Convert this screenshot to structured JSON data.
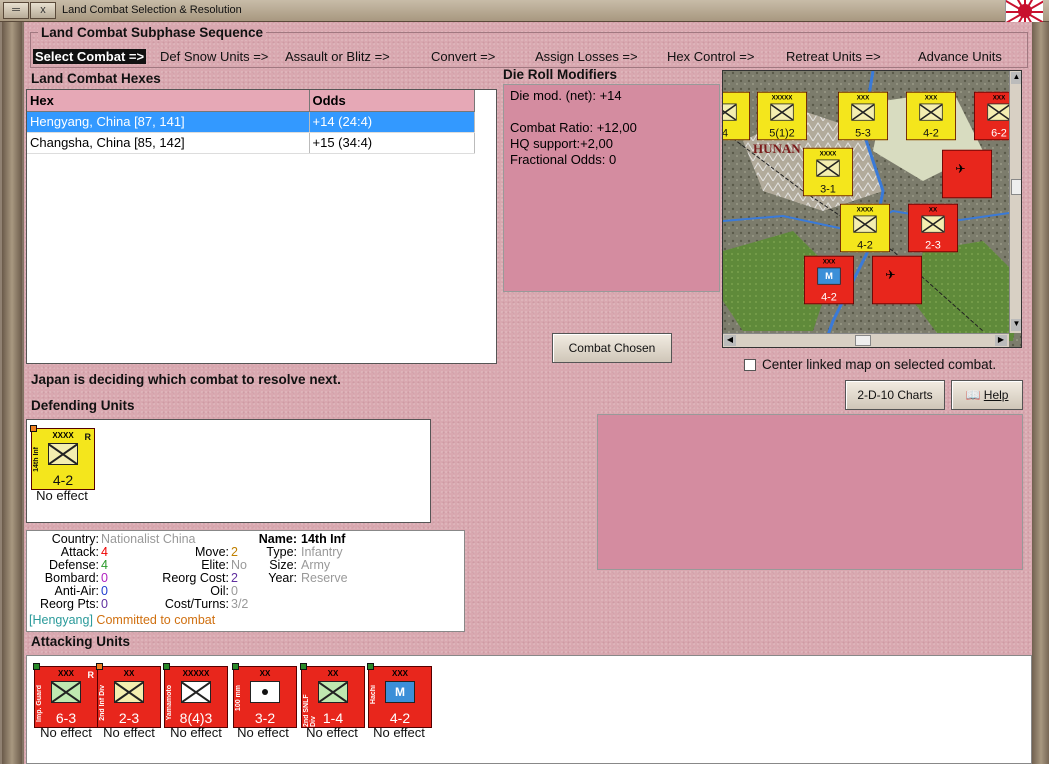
{
  "window": {
    "title": "Land Combat Selection & Resolution",
    "close_label": "x",
    "menu_label": "═"
  },
  "sequence": {
    "title": "Land Combat Subphase Sequence",
    "steps": [
      "Select Combat =>",
      "Def Snow Units =>",
      "Assault or Blitz =>",
      "Convert =>",
      "Assign Losses =>",
      "Hex Control =>",
      "Retreat Units =>",
      "Advance Units"
    ],
    "active_index": 0
  },
  "hexes": {
    "title": "Land Combat Hexes",
    "columns": [
      "Hex",
      "Odds"
    ],
    "rows": [
      {
        "hex": "Hengyang, China [87, 141]",
        "odds": "+14 (24:4)",
        "selected": true
      },
      {
        "hex": "Changsha, China [85, 142]",
        "odds": "+15 (34:4)",
        "selected": false
      }
    ]
  },
  "die_roll": {
    "title": "Die Roll Modifiers",
    "lines": [
      "Die mod. (net): +14",
      "",
      "Combat Ratio: +12,00",
      "HQ support:+2,00",
      "Fractional Odds: 0"
    ]
  },
  "buttons": {
    "combat_chosen": "Combat Chosen",
    "charts": "2-D-10 Charts",
    "help": "Help"
  },
  "center_map_label": "Center linked map on selected combat.",
  "status_message": "Japan is deciding which combat to resolve next.",
  "defending": {
    "title": "Defending Units",
    "units": [
      {
        "name": "14th Inf",
        "size": "XXXX",
        "flag": "R",
        "strength": "4-2",
        "effect": "No effect"
      }
    ]
  },
  "unit_info": {
    "country_label": "Country:",
    "country": "Nationalist China",
    "attack_label": "Attack:",
    "attack": "4",
    "defense_label": "Defense:",
    "defense": "4",
    "bombard_label": "Bombard:",
    "bombard": "0",
    "antiair_label": "Anti-Air:",
    "antiair": "0",
    "reorg_pts_label": "Reorg Pts:",
    "reorg_pts": "0",
    "move_label": "Move:",
    "move": "2",
    "elite_label": "Elite:",
    "elite": "No",
    "reorg_cost_label": "Reorg Cost:",
    "reorg_cost": "2",
    "oil_label": "Oil:",
    "oil": "0",
    "cost_turns_label": "Cost/Turns:",
    "cost_turns": "3/2",
    "name_label": "Name:",
    "name": "14th Inf",
    "type_label": "Type:",
    "type": "Infantry",
    "size_label": "Size:",
    "size": "Army",
    "year_label": "Year:",
    "year": "Reserve",
    "location": "[Hengyang]",
    "status": "Committed to combat"
  },
  "attacking": {
    "title": "Attacking Units",
    "units": [
      {
        "name": "Imp. Guard",
        "size": "XXX",
        "flag": "R",
        "strength": "6-3",
        "effect": "No effect",
        "symbol": "mountain"
      },
      {
        "name": "2nd Inf Div",
        "size": "XX",
        "flag": "",
        "strength": "2-3",
        "effect": "No effect",
        "symbol": "inf"
      },
      {
        "name": "Yamamoto",
        "size": "XXXXX",
        "flag": "",
        "strength": "8(4)3",
        "effect": "No effect",
        "symbol": "inf"
      },
      {
        "name": "100 mm",
        "size": "XX",
        "flag": "",
        "strength": "3-2",
        "effect": "No effect",
        "symbol": "art"
      },
      {
        "name": "2nd SNLF Div",
        "size": "XX",
        "flag": "",
        "strength": "1-4",
        "effect": "No effect",
        "symbol": "mountain"
      },
      {
        "name": "Hachi",
        "size": "XXX",
        "flag": "",
        "strength": "4-2",
        "effect": "No effect",
        "symbol": "mech"
      }
    ]
  },
  "map": {
    "region_label": "HUNAN",
    "counters": [
      {
        "strength": "5(1)2",
        "color": "yellow"
      },
      {
        "strength": "5-3",
        "color": "yellow"
      },
      {
        "strength": "4-2",
        "color": "yellow"
      },
      {
        "strength": "6-2",
        "color": "red"
      },
      {
        "strength": "3-1",
        "color": "yellow"
      },
      {
        "strength": "2-3",
        "color": "red"
      },
      {
        "strength": "4-2",
        "color": "red"
      },
      {
        "strength": "4",
        "color": "yellow"
      }
    ]
  }
}
